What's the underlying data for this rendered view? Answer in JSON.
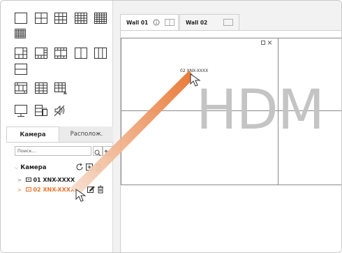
{
  "side_tabs": [
    {
      "label": "Камера"
    },
    {
      "label": "Располож."
    }
  ],
  "search": {
    "placeholder": "Поиск..."
  },
  "tree": {
    "root_label": "Камера",
    "items": [
      {
        "label": "01 XNX-XXXX",
        "color": "#222222"
      },
      {
        "label": "02 XNX-XXXX",
        "color": "#e8732d"
      }
    ]
  },
  "wall_tabs": [
    {
      "label": "Wall 01"
    },
    {
      "label": "Wall 02"
    }
  ],
  "wall": {
    "cell_label": "02 XNX-XXXX",
    "overlay_text": "HDM"
  },
  "colors": {
    "accent": "#e8732d",
    "border": "#8a8a8a"
  },
  "icons": [
    "layout-1x1-icon",
    "layout-2x2-icon",
    "layout-3x3-icon",
    "layout-4x4-icon",
    "layout-5x5-icon",
    "layout-6x6-icon",
    "layout-1plus5-icon",
    "layout-1plus7-icon",
    "layout-2plus8-icon",
    "layout-1x2-icon",
    "layout-1x3-icon",
    "layout-2x1-icon",
    "layout-3x3-alt-icon",
    "layout-4x4-alt-icon",
    "layout-4x4-a-icon",
    "monitor-icon",
    "device-icon",
    "mute-icon",
    "search-icon",
    "sort-icon",
    "refresh-icon",
    "add-icon",
    "delete-icon",
    "edit-icon",
    "camera-icon",
    "info-icon",
    "maximize-icon",
    "close-icon",
    "cursor-icon"
  ]
}
